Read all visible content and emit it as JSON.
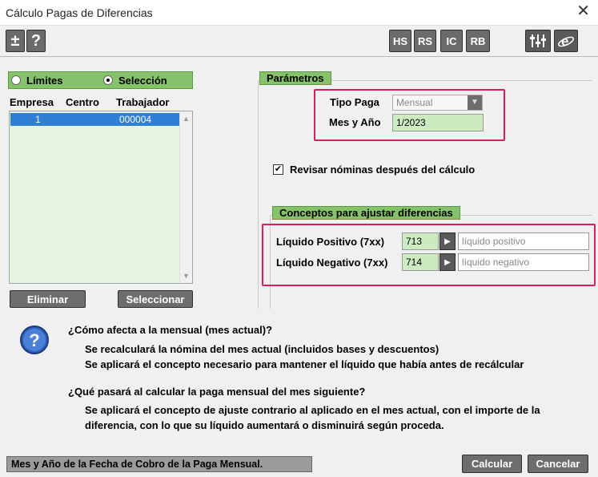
{
  "window": {
    "title": "Cálculo Pagas de Diferencias",
    "close_glyph": "✕"
  },
  "toolbar": {
    "left": [
      {
        "label": "±",
        "icon": "plus-minus-icon"
      },
      {
        "label": "?",
        "icon": "help-icon"
      }
    ],
    "right": [
      {
        "label": "HS"
      },
      {
        "label": "RS"
      },
      {
        "label": "IC"
      },
      {
        "label": "RB"
      }
    ],
    "extra": [
      {
        "icon": "sliders-icon",
        "glyph": "⫶⫶"
      },
      {
        "icon": "internet-explorer-icon",
        "glyph": "e"
      }
    ]
  },
  "left_panel": {
    "radio_limits": "Límites",
    "radio_selection": "Selección",
    "selected_radio": "Selección",
    "columns": [
      "Empresa",
      "Centro",
      "Trabajador"
    ],
    "rows": [
      {
        "empresa": "1",
        "centro": "",
        "trabajador": "000004"
      }
    ],
    "remove_button": "Eliminar",
    "select_button": "Seleccionar"
  },
  "parameters": {
    "group_title": "Parámetros",
    "tipo_paga_label": "Tipo Paga",
    "tipo_paga_value": "Mensual",
    "mes_anio_label": "Mes y Año",
    "mes_anio_value": "1/2023",
    "revisar_label": "Revisar nóminas después del cálculo",
    "revisar_checked": true
  },
  "concepts": {
    "group_title": "Conceptos para ajustar diferencias",
    "positive_label": "Líquido Positivo (7xx)",
    "positive_code": "713",
    "positive_desc": "líquido positivo",
    "negative_label": "Líquido Negativo (7xx)",
    "negative_code": "714",
    "negative_desc": "líquido negativo"
  },
  "info": {
    "q1": "¿Cómo afecta a la mensual (mes actual)?",
    "q1_line1": "Se recalculará la nómina del mes actual (incluidos bases y descuentos)",
    "q1_line2": "Se aplicará el concepto necesario para mantener el líquido que había antes de recálcular",
    "q2": "¿Qué pasará al calcular la paga mensual del mes siguiente?",
    "q2_line1": "Se aplicará el concepto de ajuste contrario al aplicado en el mes actual, con el importe de la",
    "q2_line2": "diferencia, con lo que su líquido aumentará o disminuirá según proceda."
  },
  "status_text": "Mes y Año de la Fecha de Cobro de la Paga Mensual.",
  "footer": {
    "calc_button": "Calcular",
    "cancel_button": "Cancelar"
  },
  "colors": {
    "accent_green": "#86c26a",
    "highlight_red": "#d81e5b",
    "selection_blue": "#2f7fd4"
  }
}
